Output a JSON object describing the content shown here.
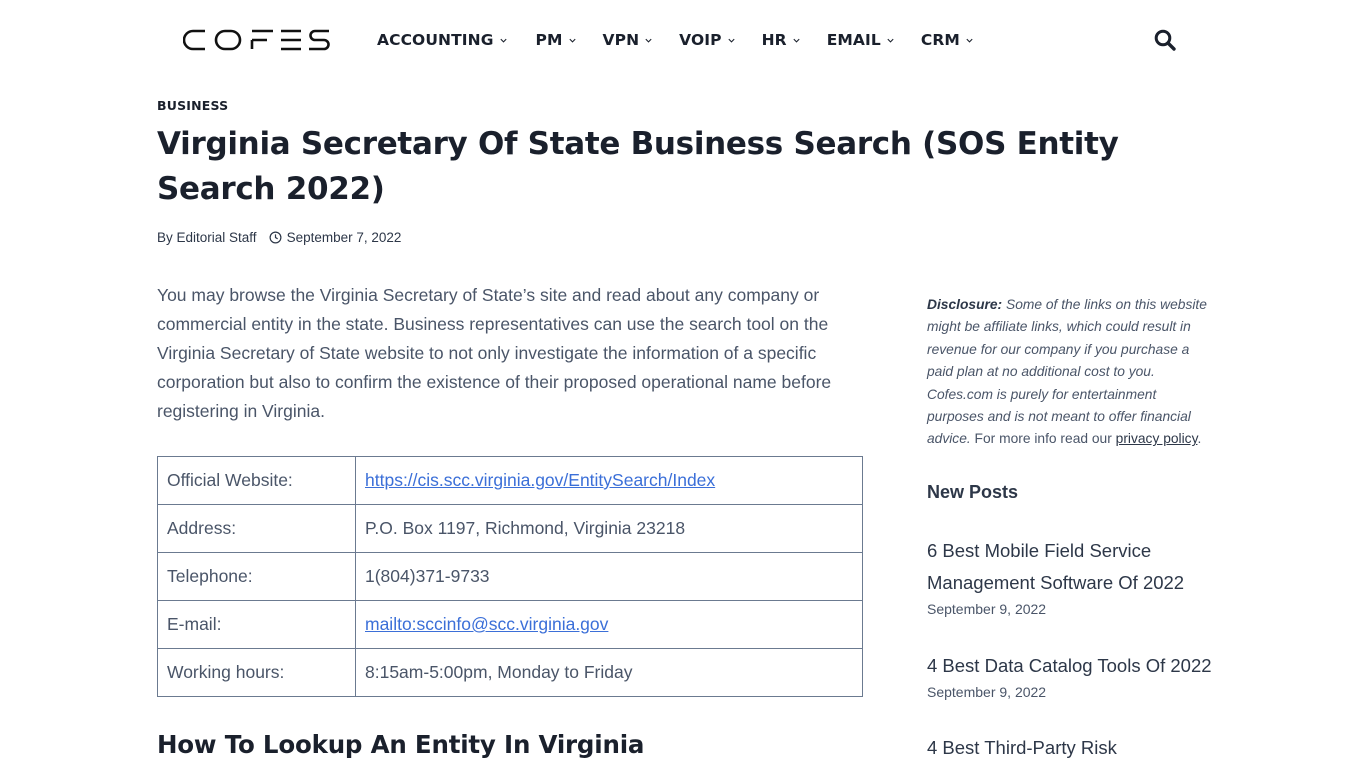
{
  "header": {
    "logo_text": "COFES",
    "nav": [
      {
        "label": "ACCOUNTING"
      },
      {
        "label": "PM"
      },
      {
        "label": "VPN"
      },
      {
        "label": "VOIP"
      },
      {
        "label": "HR"
      },
      {
        "label": "EMAIL"
      },
      {
        "label": "CRM"
      }
    ],
    "search_icon": "search-icon"
  },
  "article": {
    "category": "BUSINESS",
    "title": "Virginia Secretary Of State Business Search (SOS Entity Search 2022)",
    "author": "By Editorial Staff",
    "date": "September 7, 2022",
    "intro": "You may browse the Virginia Secretary of State’s site and read about any company or commercial entity in the state. Business representatives can use the search tool on the Virginia Secretary of State website to not only investigate the information of a specific corporation but also to confirm the existence of their proposed operational name before registering in Virginia.",
    "table": [
      {
        "label": "Official Website:",
        "value": "https://cis.scc.virginia.gov/EntitySearch/Index",
        "link": true
      },
      {
        "label": "Address:",
        "value": "P.O. Box 1197, Richmond, Virginia 23218",
        "link": false
      },
      {
        "label": "Telephone:",
        "value": "1(804)371-9733",
        "link": false
      },
      {
        "label": "E-mail:",
        "value": "mailto:sccinfo@scc.virginia.gov",
        "link": true
      },
      {
        "label": "Working hours:",
        "value": "8:15am-5:00pm, Monday to Friday",
        "link": false
      }
    ],
    "section_heading": "How To Lookup An Entity In Virginia"
  },
  "sidebar": {
    "disclosure": {
      "label": "Disclosure:",
      "italic_text": " Some of the links on this website might be affiliate links, which could result in revenue for our company if you purchase a paid plan at no additional cost to you. Cofes.com is purely for entertainment purposes and is not meant to offer financial advice.",
      "plain_text": " For more info read our ",
      "link_text": "privacy policy",
      "end": "."
    },
    "new_posts_title": "New Posts",
    "posts": [
      {
        "title": "6 Best Mobile Field Service Management Software Of 2022",
        "date": "September 9, 2022"
      },
      {
        "title": "4 Best Data Catalog Tools Of 2022",
        "date": "September 9, 2022"
      },
      {
        "title": "4 Best Third-Party Risk",
        "date": ""
      }
    ]
  },
  "colors": {
    "text_dark": "#1a202c",
    "text_body": "#4a5568",
    "link": "#3b6fd8",
    "table_border": "#6b7a90"
  }
}
